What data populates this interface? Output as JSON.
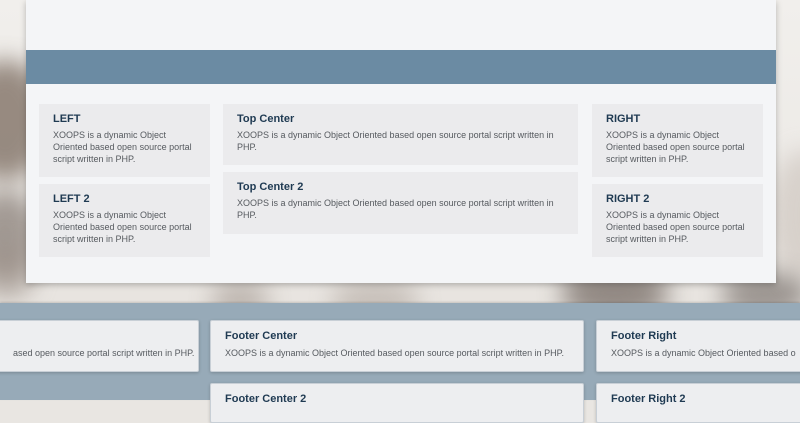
{
  "blocks": {
    "left": {
      "title": "LEFT",
      "text": "XOOPS is a dynamic Object Oriented based open source portal script written in PHP."
    },
    "left2": {
      "title": "LEFT 2",
      "text": "XOOPS is a dynamic Object Oriented based open source portal script written in PHP."
    },
    "top_center": {
      "title": "Top Center",
      "text": "XOOPS is a dynamic Object Oriented based open source portal script written in PHP."
    },
    "top_center2": {
      "title": "Top Center 2",
      "text": "XOOPS is a dynamic Object Oriented based open source portal script written in PHP."
    },
    "right": {
      "title": "RIGHT",
      "text": "XOOPS is a dynamic Object Oriented based open source portal script written in PHP."
    },
    "right2": {
      "title": "RIGHT 2",
      "text": "XOOPS is a dynamic Object Oriented based open source portal script written in PHP."
    }
  },
  "footer": {
    "left": {
      "text": "ased open source portal script written in PHP."
    },
    "center": {
      "title": "Footer Center",
      "text": "XOOPS is a dynamic Object Oriented based open source portal script written in PHP."
    },
    "right": {
      "title": "Footer Right",
      "text": "XOOPS is a dynamic Object Oriented based o"
    },
    "center2": {
      "title": "Footer Center 2"
    },
    "right2": {
      "title": "Footer Right 2"
    }
  },
  "colors": {
    "header_band": "#6b8ba3",
    "footer_band": "#97aab8",
    "block_bg": "#ebebed",
    "title_text": "#1f3a52"
  }
}
